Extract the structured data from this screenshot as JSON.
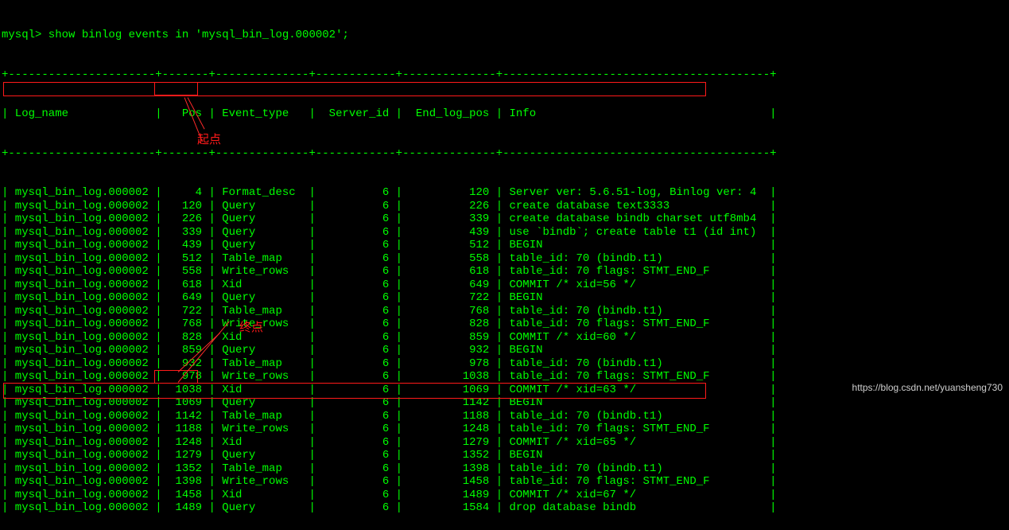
{
  "prompt_line": "mysql> show binlog events in 'mysql_bin_log.000002';",
  "header": {
    "log_name": "Log_name",
    "pos": "Pos",
    "event_type": "Event_type",
    "server_id": "Server_id",
    "end_log_pos": "End_log_pos",
    "info": "Info"
  },
  "rows": [
    {
      "log_name": "mysql_bin_log.000002",
      "pos": "4",
      "event_type": "Format_desc",
      "server_id": "6",
      "end_log_pos": "120",
      "info": "Server ver: 5.6.51-log, Binlog ver: 4"
    },
    {
      "log_name": "mysql_bin_log.000002",
      "pos": "120",
      "event_type": "Query",
      "server_id": "6",
      "end_log_pos": "226",
      "info": "create database text3333"
    },
    {
      "log_name": "mysql_bin_log.000002",
      "pos": "226",
      "event_type": "Query",
      "server_id": "6",
      "end_log_pos": "339",
      "info": "create database bindb charset utf8mb4"
    },
    {
      "log_name": "mysql_bin_log.000002",
      "pos": "339",
      "event_type": "Query",
      "server_id": "6",
      "end_log_pos": "439",
      "info": "use `bindb`; create table t1 (id int)"
    },
    {
      "log_name": "mysql_bin_log.000002",
      "pos": "439",
      "event_type": "Query",
      "server_id": "6",
      "end_log_pos": "512",
      "info": "BEGIN"
    },
    {
      "log_name": "mysql_bin_log.000002",
      "pos": "512",
      "event_type": "Table_map",
      "server_id": "6",
      "end_log_pos": "558",
      "info": "table_id: 70 (bindb.t1)"
    },
    {
      "log_name": "mysql_bin_log.000002",
      "pos": "558",
      "event_type": "Write_rows",
      "server_id": "6",
      "end_log_pos": "618",
      "info": "table_id: 70 flags: STMT_END_F"
    },
    {
      "log_name": "mysql_bin_log.000002",
      "pos": "618",
      "event_type": "Xid",
      "server_id": "6",
      "end_log_pos": "649",
      "info": "COMMIT /* xid=56 */"
    },
    {
      "log_name": "mysql_bin_log.000002",
      "pos": "649",
      "event_type": "Query",
      "server_id": "6",
      "end_log_pos": "722",
      "info": "BEGIN"
    },
    {
      "log_name": "mysql_bin_log.000002",
      "pos": "722",
      "event_type": "Table_map",
      "server_id": "6",
      "end_log_pos": "768",
      "info": "table_id: 70 (bindb.t1)"
    },
    {
      "log_name": "mysql_bin_log.000002",
      "pos": "768",
      "event_type": "Write_rows",
      "server_id": "6",
      "end_log_pos": "828",
      "info": "table_id: 70 flags: STMT_END_F"
    },
    {
      "log_name": "mysql_bin_log.000002",
      "pos": "828",
      "event_type": "Xid",
      "server_id": "6",
      "end_log_pos": "859",
      "info": "COMMIT /* xid=60 */"
    },
    {
      "log_name": "mysql_bin_log.000002",
      "pos": "859",
      "event_type": "Query",
      "server_id": "6",
      "end_log_pos": "932",
      "info": "BEGIN"
    },
    {
      "log_name": "mysql_bin_log.000002",
      "pos": "932",
      "event_type": "Table_map",
      "server_id": "6",
      "end_log_pos": "978",
      "info": "table_id: 70 (bindb.t1)"
    },
    {
      "log_name": "mysql_bin_log.000002",
      "pos": "978",
      "event_type": "Write_rows",
      "server_id": "6",
      "end_log_pos": "1038",
      "info": "table_id: 70 flags: STMT_END_F"
    },
    {
      "log_name": "mysql_bin_log.000002",
      "pos": "1038",
      "event_type": "Xid",
      "server_id": "6",
      "end_log_pos": "1069",
      "info": "COMMIT /* xid=63 */"
    },
    {
      "log_name": "mysql_bin_log.000002",
      "pos": "1069",
      "event_type": "Query",
      "server_id": "6",
      "end_log_pos": "1142",
      "info": "BEGIN"
    },
    {
      "log_name": "mysql_bin_log.000002",
      "pos": "1142",
      "event_type": "Table_map",
      "server_id": "6",
      "end_log_pos": "1188",
      "info": "table_id: 70 (bindb.t1)"
    },
    {
      "log_name": "mysql_bin_log.000002",
      "pos": "1188",
      "event_type": "Write_rows",
      "server_id": "6",
      "end_log_pos": "1248",
      "info": "table_id: 70 flags: STMT_END_F"
    },
    {
      "log_name": "mysql_bin_log.000002",
      "pos": "1248",
      "event_type": "Xid",
      "server_id": "6",
      "end_log_pos": "1279",
      "info": "COMMIT /* xid=65 */"
    },
    {
      "log_name": "mysql_bin_log.000002",
      "pos": "1279",
      "event_type": "Query",
      "server_id": "6",
      "end_log_pos": "1352",
      "info": "BEGIN"
    },
    {
      "log_name": "mysql_bin_log.000002",
      "pos": "1352",
      "event_type": "Table_map",
      "server_id": "6",
      "end_log_pos": "1398",
      "info": "table_id: 70 (bindb.t1)"
    },
    {
      "log_name": "mysql_bin_log.000002",
      "pos": "1398",
      "event_type": "Write_rows",
      "server_id": "6",
      "end_log_pos": "1458",
      "info": "table_id: 70 flags: STMT_END_F"
    },
    {
      "log_name": "mysql_bin_log.000002",
      "pos": "1458",
      "event_type": "Xid",
      "server_id": "6",
      "end_log_pos": "1489",
      "info": "COMMIT /* xid=67 */"
    },
    {
      "log_name": "mysql_bin_log.000002",
      "pos": "1489",
      "event_type": "Query",
      "server_id": "6",
      "end_log_pos": "1584",
      "info": "drop database bindb"
    }
  ],
  "annotations": {
    "start": "起点",
    "end": "终点"
  },
  "watermark": "https://blog.csdn.net/yuansheng730"
}
